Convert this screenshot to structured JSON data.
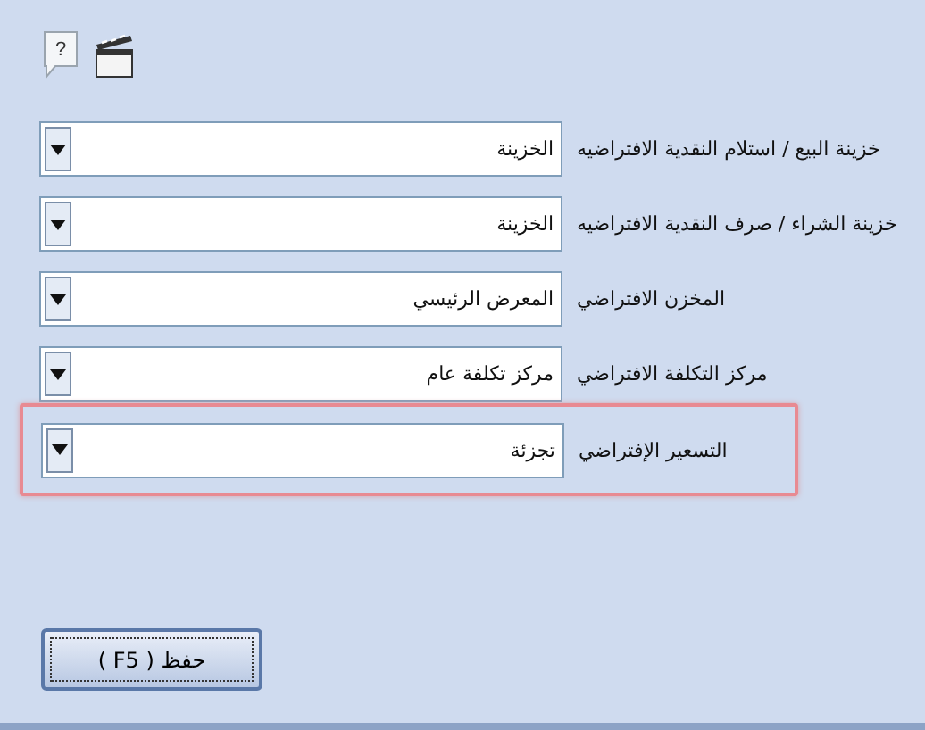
{
  "toolbar": [
    {
      "kind": "help",
      "glyph": "?"
    },
    {
      "kind": "clapper"
    }
  ],
  "fields": [
    {
      "label": "خزينة البيع / استلام النقدية الافتراضيه",
      "value": "الخزينة",
      "highlighted": false
    },
    {
      "label": "خزينة الشراء / صرف النقدية الافتراضيه",
      "value": "الخزينة",
      "highlighted": false
    },
    {
      "label": "المخزن الافتراضي",
      "value": "المعرض الرئيسي",
      "highlighted": false
    },
    {
      "label": "مركز التكلفة الافتراضي",
      "value": "مركز تكلفة عام",
      "highlighted": false
    },
    {
      "label": "التسعير الإفتراضي",
      "value": "تجزئة",
      "highlighted": true
    }
  ],
  "save_button": {
    "label": "حفظ ( F5 )"
  }
}
